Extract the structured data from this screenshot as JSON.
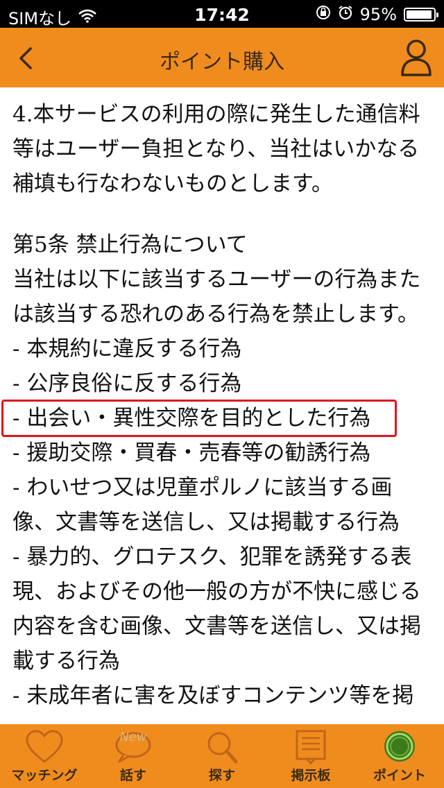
{
  "status_bar": {
    "carrier": "SIMなし",
    "time": "17:42",
    "battery": "95%",
    "battery_level": 0.95,
    "icons": [
      "wifi-icon",
      "orientation-lock-icon",
      "alarm-icon",
      "battery-icon"
    ]
  },
  "nav": {
    "title": "ポイント購入",
    "back_icon": "chevron-left-icon",
    "user_icon": "user-icon"
  },
  "content": {
    "lines": [
      "4.本サービスの利用の際に発生した通信料",
      "等はユーザー負担となり、当社はいかなる",
      "補填も行なわないものとします。",
      "",
      "第5条 禁止行為について",
      "当社は以下に該当するユーザーの行為また",
      "は該当する恐れのある行為を禁止します。",
      "- 本規約に違反する行為",
      "- 公序良俗に反する行為",
      "- 出会い・異性交際を目的とした行為",
      "- 援助交際・買春・売春等の勧誘行為",
      "- わいせつ又は児童ポルノに該当する画",
      "像、文書等を送信し、又は掲載する行為",
      "- 暴力的、グロテスク、犯罪を誘発する表",
      "現、およびその他一般の方が不快に感じる",
      "内容を含む画像、文書等を送信し、又は掲",
      "載する行為",
      "- 未成年者に害を及ぼすコンテンツ等を掲"
    ],
    "highlight_color": "#e0141e"
  },
  "tabbar": {
    "tabs": [
      {
        "label": "マッチング",
        "icon": "heart-icon"
      },
      {
        "label": "話す",
        "icon": "speech-bubble-icon",
        "badge": "New"
      },
      {
        "label": "探す",
        "icon": "magnifier-icon"
      },
      {
        "label": "掲示板",
        "icon": "board-icon"
      },
      {
        "label": "ポイント",
        "icon": "coin-icon",
        "active": true
      }
    ]
  },
  "colors": {
    "nav_background": "#f08c1e",
    "nav_text": "#3a2a14",
    "active_icon": "#4a8a1e"
  }
}
